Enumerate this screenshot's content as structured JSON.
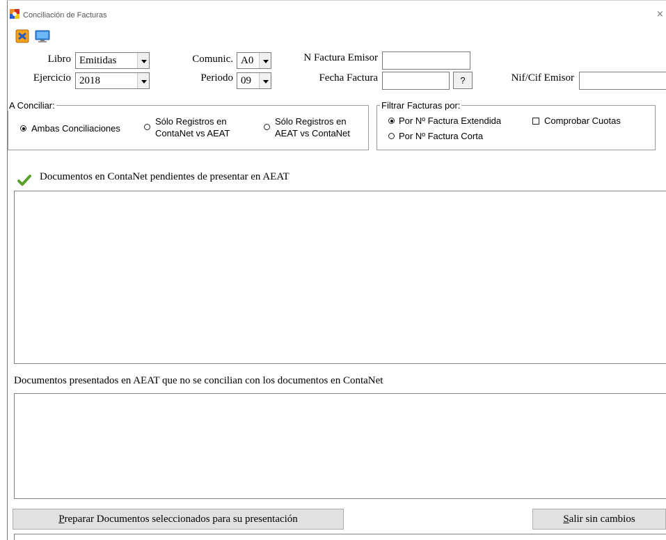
{
  "window": {
    "title": "Conciliación de Facturas",
    "close_glyph": "×",
    "icons": [
      "app-logo-icon"
    ]
  },
  "toolbar": {
    "icons": [
      "refresh-icon",
      "monitor-icon"
    ]
  },
  "form": {
    "libro_label": "Libro",
    "libro_value": "Emitidas",
    "ejercicio_label": "Ejercicio",
    "ejercicio_value": "2018",
    "comunic_label": "Comunic.",
    "comunic_value": "A0",
    "periodo_label": "Periodo",
    "periodo_value": "09",
    "nfactura_label": "N Factura Emisor",
    "nfactura_value": "",
    "fecha_label": "Fecha Factura",
    "fecha_value": "",
    "fecha_button": "?",
    "nif_label": "Nif/Cif Emisor",
    "nif_value": ""
  },
  "a_conciliar": {
    "title": "A Conciliar:",
    "options": [
      {
        "label": "Ambas Conciliaciones",
        "selected": true
      },
      {
        "label_line1": "Sólo Registros en",
        "label_line2": "ContaNet vs AEAT",
        "selected": false
      },
      {
        "label_line1": "Sólo Registros en",
        "label_line2": "AEAT vs ContaNet",
        "selected": false
      }
    ]
  },
  "filtrar": {
    "title": "Filtrar Facturas por:",
    "options": [
      {
        "label": "Por Nº Factura Extendida",
        "selected": true
      },
      {
        "label": "Por Nº Factura Corta",
        "selected": false
      }
    ],
    "check_label": "Comprobar Cuotas",
    "check_checked": false
  },
  "lists": {
    "pending_label": "Documentos en ContaNet pendientes de presentar en AEAT",
    "pending_icon": "checkmark-icon",
    "unmatched_label": "Documentos presentados en AEAT que no se concilian con los documentos en  ContaNet"
  },
  "buttons": {
    "prepare_label": "reparar Documentos seleccionados para su presentación",
    "prepare_mnemonic": "P",
    "exit_label": "alir sin cambios",
    "exit_mnemonic": "S"
  },
  "colors": {
    "check_green": "#5aa02c",
    "button_face": "#e1e1e1",
    "border": "#828282"
  }
}
